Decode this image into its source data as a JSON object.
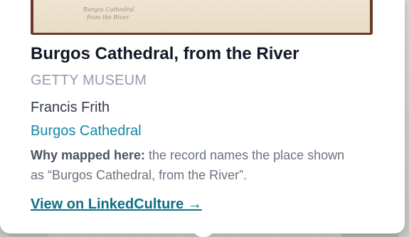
{
  "popup": {
    "image": {
      "inscription": "Burgos Cathedral\n  from the River"
    },
    "title": "Burgos Cathedral, from the River",
    "source": "GETTY MUSEUM",
    "creator": "Francis Frith",
    "place_link": "Burgos Cathedral",
    "why": {
      "label": "Why mapped here:",
      "text": " the record names the place shown as “Burgos Cathedral, from the River”."
    },
    "view_link": "View on LinkedCulture →"
  }
}
